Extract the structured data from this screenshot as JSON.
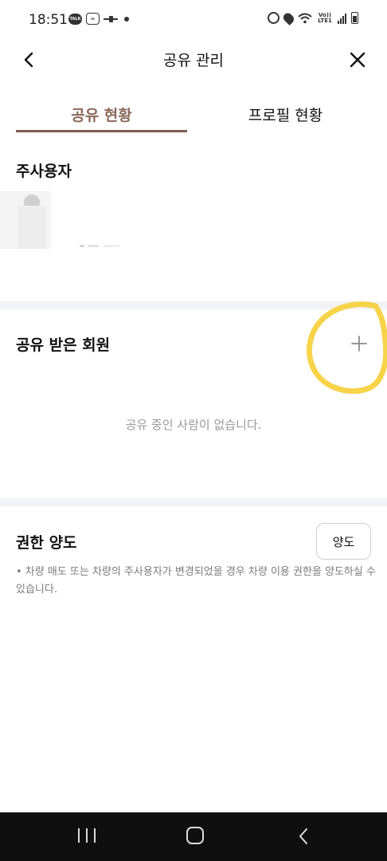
{
  "status_bar": {
    "time": "18:51",
    "talk_badge": "TALK",
    "lte_label": "Vo)) LTE1"
  },
  "header": {
    "title": "공유 관리"
  },
  "tabs": [
    {
      "label": "공유 현황",
      "active": true
    },
    {
      "label": "프로필 현황",
      "active": false
    }
  ],
  "owner_section": {
    "title": "주사용자"
  },
  "shared_section": {
    "title": "공유 받은 회원",
    "empty_message": "공유 중인 사람이 없습니다."
  },
  "transfer_section": {
    "title": "권한 양도",
    "button_label": "양도",
    "description": "• 차량 매도 또는 차량의 주사용자가 변경되었을 경우 차량 이용 권한을 양도하실 수 있습니다."
  },
  "icons": {
    "back": "chevron-left-icon",
    "close": "close-icon",
    "add": "plus-icon"
  },
  "colors": {
    "active_tab": "#8a6a5a",
    "tab_underline": "#7d5f50",
    "section_divider": "#f1f3f7",
    "annotation": "#f7d34a",
    "nav_bar": "#0f0f0f"
  }
}
